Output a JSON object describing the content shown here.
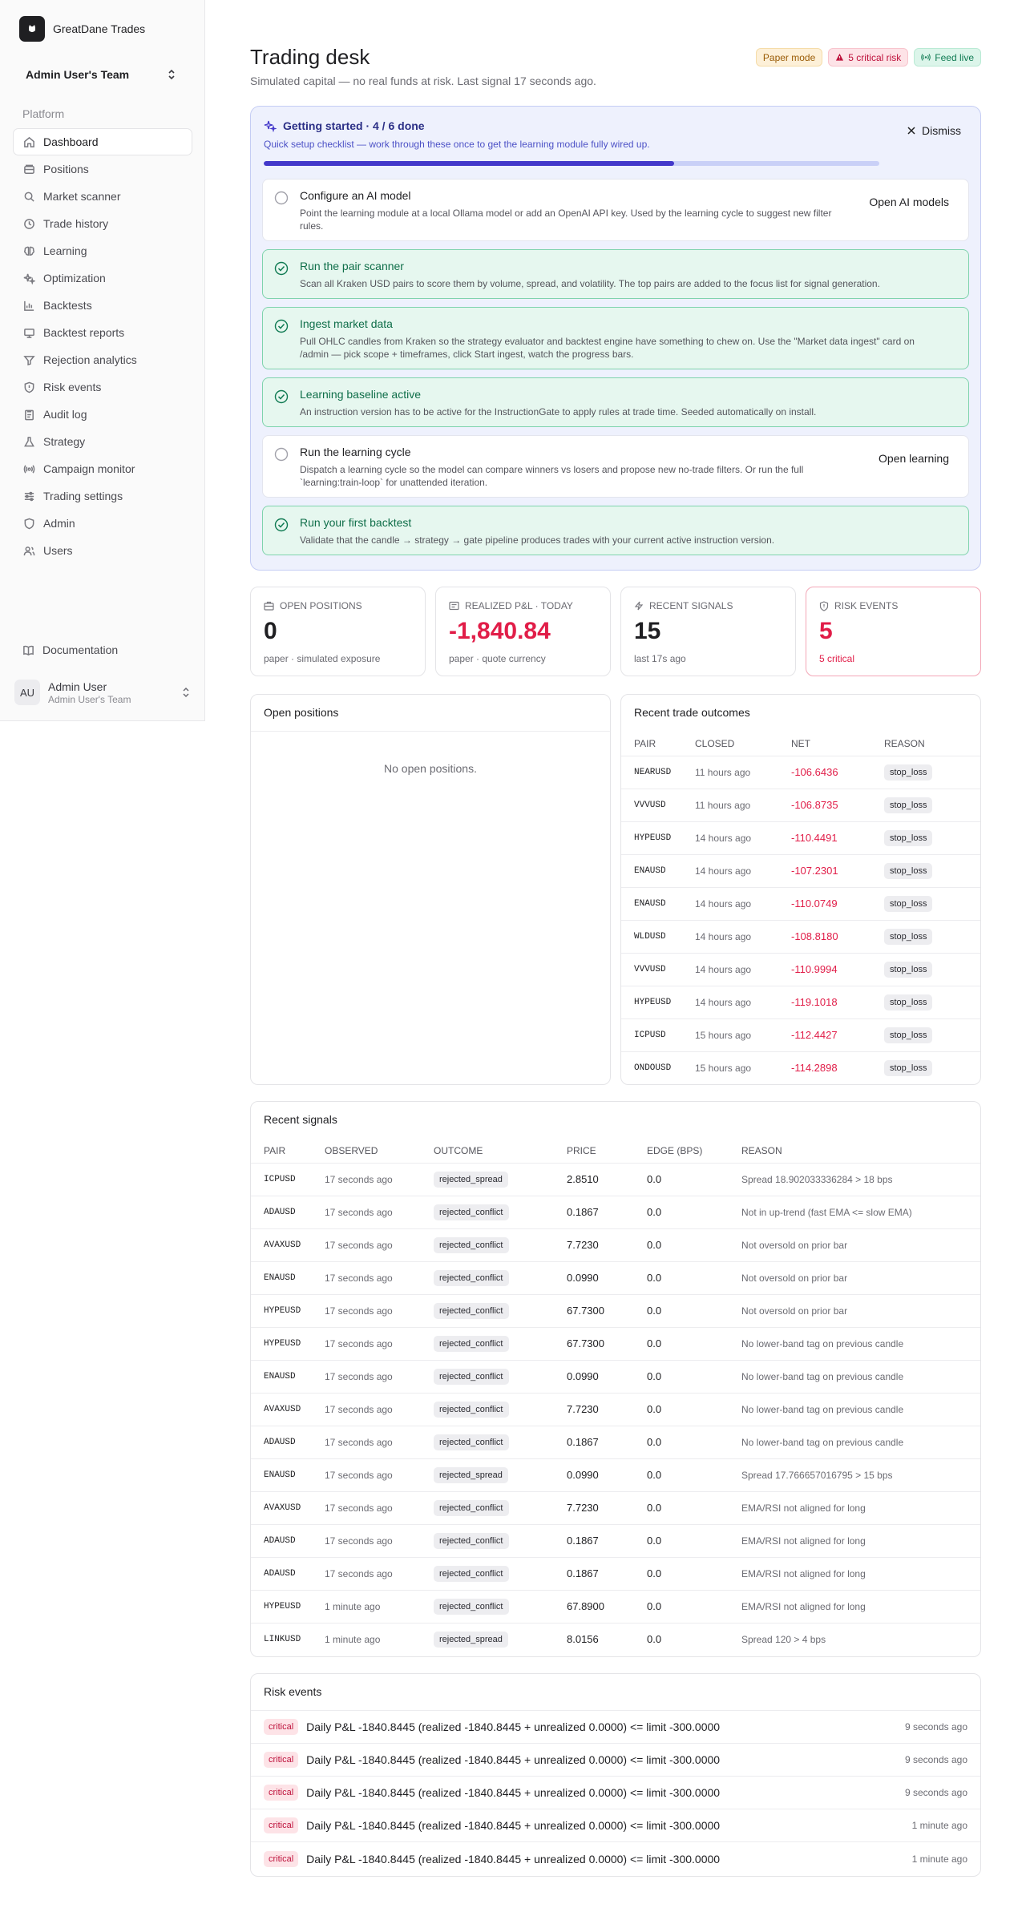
{
  "brand": {
    "name": "GreatDane Trades"
  },
  "team": {
    "name": "Admin User's Team"
  },
  "nav": {
    "group_label": "Platform",
    "items": [
      {
        "label": "Dashboard",
        "icon": "home-icon"
      },
      {
        "label": "Positions",
        "icon": "wallet-icon"
      },
      {
        "label": "Market scanner",
        "icon": "search-icon"
      },
      {
        "label": "Trade history",
        "icon": "history-icon"
      },
      {
        "label": "Learning",
        "icon": "brain-icon"
      },
      {
        "label": "Optimization",
        "icon": "sparkles-icon"
      },
      {
        "label": "Backtests",
        "icon": "chart-icon"
      },
      {
        "label": "Backtest reports",
        "icon": "report-icon"
      },
      {
        "label": "Rejection analytics",
        "icon": "filter-icon"
      },
      {
        "label": "Risk events",
        "icon": "shield-alert-icon"
      },
      {
        "label": "Audit log",
        "icon": "clipboard-icon"
      },
      {
        "label": "Strategy",
        "icon": "flask-icon"
      },
      {
        "label": "Campaign monitor",
        "icon": "radio-icon"
      },
      {
        "label": "Trading settings",
        "icon": "sliders-icon"
      },
      {
        "label": "Admin",
        "icon": "shield-icon"
      },
      {
        "label": "Users",
        "icon": "users-icon"
      }
    ],
    "documentation": "Documentation"
  },
  "user": {
    "initials": "AU",
    "name": "Admin User",
    "team": "Admin User's Team"
  },
  "header": {
    "title": "Trading desk",
    "subtitle": "Simulated capital — no real funds at risk. Last signal 17 seconds ago.",
    "badges": {
      "paper": "Paper mode",
      "risk": "5 critical risk",
      "live": "Feed live"
    }
  },
  "onboarding": {
    "title": "Getting started · 4 / 6 done",
    "description": "Quick setup checklist — work through these once to get the learning module fully wired up.",
    "progress": 0.667,
    "dismiss": "Dismiss",
    "steps": [
      {
        "title": "Configure an AI model",
        "description": "Point the learning module at a local Ollama model or add an OpenAI API key. Used by the learning cycle to suggest new filter rules.",
        "done": false,
        "action": "Open AI models"
      },
      {
        "title": "Run the pair scanner",
        "description": "Scan all Kraken USD pairs to score them by volume, spread, and volatility. The top pairs are added to the focus list for signal generation.",
        "done": true,
        "action": ""
      },
      {
        "title": "Ingest market data",
        "description": "Pull OHLC candles from Kraken so the strategy evaluator and backtest engine have something to chew on. Use the \"Market data ingest\" card on /admin — pick scope + timeframes, click Start ingest, watch the progress bars.",
        "done": true,
        "action": ""
      },
      {
        "title": "Learning baseline active",
        "description": "An instruction version has to be active for the InstructionGate to apply rules at trade time. Seeded automatically on install.",
        "done": true,
        "action": ""
      },
      {
        "title": "Run the learning cycle",
        "description": "Dispatch a learning cycle so the model can compare winners vs losers and propose new no-trade filters. Or run the full `learning:train-loop` for unattended iteration.",
        "done": false,
        "action": "Open learning"
      },
      {
        "title": "Run your first backtest",
        "description": "Validate that the candle → strategy → gate pipeline produces trades with your current active instruction version.",
        "done": true,
        "action": ""
      }
    ]
  },
  "stats": [
    {
      "label": "Open positions",
      "value": "0",
      "sub": "paper · simulated exposure",
      "icon": "briefcase-icon"
    },
    {
      "label": "Realized P&L · today",
      "value": "-1,840.84",
      "sub": "paper · quote currency",
      "icon": "receipt-icon"
    },
    {
      "label": "Recent signals",
      "value": "15",
      "sub": "last 17s ago",
      "icon": "zap-icon"
    },
    {
      "label": "Risk events",
      "value": "5",
      "sub": "5 critical",
      "icon": "shield-alert-icon"
    }
  ],
  "open_positions": {
    "title": "Open positions",
    "empty": "No open positions."
  },
  "trade_outcomes": {
    "title": "Recent trade outcomes",
    "columns": [
      "Pair",
      "Closed",
      "Net",
      "Reason"
    ],
    "rows": [
      [
        "NEARUSD",
        "11 hours ago",
        "-106.6436",
        "stop_loss"
      ],
      [
        "VVVUSD",
        "11 hours ago",
        "-106.8735",
        "stop_loss"
      ],
      [
        "HYPEUSD",
        "14 hours ago",
        "-110.4491",
        "stop_loss"
      ],
      [
        "ENAUSD",
        "14 hours ago",
        "-107.2301",
        "stop_loss"
      ],
      [
        "ENAUSD",
        "14 hours ago",
        "-110.0749",
        "stop_loss"
      ],
      [
        "WLDUSD",
        "14 hours ago",
        "-108.8180",
        "stop_loss"
      ],
      [
        "VVVUSD",
        "14 hours ago",
        "-110.9994",
        "stop_loss"
      ],
      [
        "HYPEUSD",
        "14 hours ago",
        "-119.1018",
        "stop_loss"
      ],
      [
        "ICPUSD",
        "15 hours ago",
        "-112.4427",
        "stop_loss"
      ],
      [
        "ONDOUSD",
        "15 hours ago",
        "-114.2898",
        "stop_loss"
      ]
    ]
  },
  "recent_signals": {
    "title": "Recent signals",
    "columns": [
      "Pair",
      "Observed",
      "Outcome",
      "Price",
      "Edge (bps)",
      "Reason"
    ],
    "rows": [
      [
        "ICPUSD",
        "17 seconds ago",
        "rejected_spread",
        "2.8510",
        "0.0",
        "Spread 18.902033336284 > 18 bps"
      ],
      [
        "ADAUSD",
        "17 seconds ago",
        "rejected_conflict",
        "0.1867",
        "0.0",
        "Not in up-trend (fast EMA <= slow EMA)"
      ],
      [
        "AVAXUSD",
        "17 seconds ago",
        "rejected_conflict",
        "7.7230",
        "0.0",
        "Not oversold on prior bar"
      ],
      [
        "ENAUSD",
        "17 seconds ago",
        "rejected_conflict",
        "0.0990",
        "0.0",
        "Not oversold on prior bar"
      ],
      [
        "HYPEUSD",
        "17 seconds ago",
        "rejected_conflict",
        "67.7300",
        "0.0",
        "Not oversold on prior bar"
      ],
      [
        "HYPEUSD",
        "17 seconds ago",
        "rejected_conflict",
        "67.7300",
        "0.0",
        "No lower-band tag on previous candle"
      ],
      [
        "ENAUSD",
        "17 seconds ago",
        "rejected_conflict",
        "0.0990",
        "0.0",
        "No lower-band tag on previous candle"
      ],
      [
        "AVAXUSD",
        "17 seconds ago",
        "rejected_conflict",
        "7.7230",
        "0.0",
        "No lower-band tag on previous candle"
      ],
      [
        "ADAUSD",
        "17 seconds ago",
        "rejected_conflict",
        "0.1867",
        "0.0",
        "No lower-band tag on previous candle"
      ],
      [
        "ENAUSD",
        "17 seconds ago",
        "rejected_spread",
        "0.0990",
        "0.0",
        "Spread 17.766657016795 > 15 bps"
      ],
      [
        "AVAXUSD",
        "17 seconds ago",
        "rejected_conflict",
        "7.7230",
        "0.0",
        "EMA/RSI not aligned for long"
      ],
      [
        "ADAUSD",
        "17 seconds ago",
        "rejected_conflict",
        "0.1867",
        "0.0",
        "EMA/RSI not aligned for long"
      ],
      [
        "ADAUSD",
        "17 seconds ago",
        "rejected_conflict",
        "0.1867",
        "0.0",
        "EMA/RSI not aligned for long"
      ],
      [
        "HYPEUSD",
        "1 minute ago",
        "rejected_conflict",
        "67.8900",
        "0.0",
        "EMA/RSI not aligned for long"
      ],
      [
        "LINKUSD",
        "1 minute ago",
        "rejected_spread",
        "8.0156",
        "0.0",
        "Spread 120 > 4 bps"
      ]
    ]
  },
  "risk_events": {
    "title": "Risk events",
    "rows": [
      {
        "severity": "critical",
        "message": "Daily P&L -1840.8445 (realized -1840.8445 + unrealized 0.0000) <= limit -300.0000",
        "time": "9 seconds ago"
      },
      {
        "severity": "critical",
        "message": "Daily P&L -1840.8445 (realized -1840.8445 + unrealized 0.0000) <= limit -300.0000",
        "time": "9 seconds ago"
      },
      {
        "severity": "critical",
        "message": "Daily P&L -1840.8445 (realized -1840.8445 + unrealized 0.0000) <= limit -300.0000",
        "time": "9 seconds ago"
      },
      {
        "severity": "critical",
        "message": "Daily P&L -1840.8445 (realized -1840.8445 + unrealized 0.0000) <= limit -300.0000",
        "time": "1 minute ago"
      },
      {
        "severity": "critical",
        "message": "Daily P&L -1840.8445 (realized -1840.8445 + unrealized 0.0000) <= limit -300.0000",
        "time": "1 minute ago"
      }
    ]
  },
  "colors": {
    "accent": "#4338ca",
    "negative": "#e11d48",
    "success": "#0f7a52"
  }
}
